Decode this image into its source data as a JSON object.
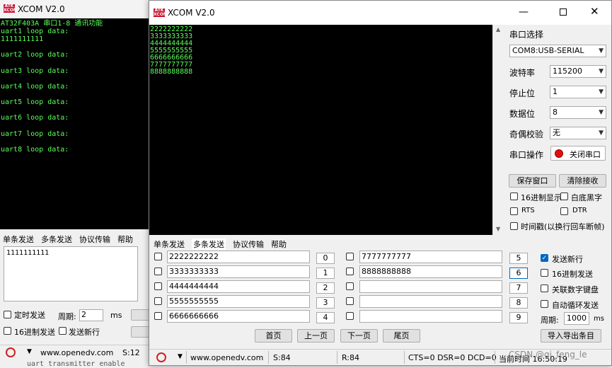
{
  "app_title": "XCOM V2.0",
  "logo_text": "ATK XCOM",
  "back": {
    "terminal_lines": [
      "AT32F403A 串口1-8 通讯功能",
      "uart1 loop data:",
      "1111111111",
      "",
      "uart2 loop data:",
      "",
      "uart3 loop data:",
      "",
      "uart4 loop data:",
      "",
      "uart5 loop data:",
      "",
      "uart6 loop data:",
      "",
      "uart7 loop data:",
      "",
      "uart8 loop data:"
    ],
    "tabs": [
      "单条发送",
      "多条发送",
      "协议传输",
      "帮助"
    ],
    "send_text": "1111111111",
    "timed_send": "定时发送",
    "period_label": "周期:",
    "period_value": "2",
    "period_unit": "ms",
    "hex_send": "16进制发送",
    "send_newline": "发送新行",
    "website": "www.openedv.com",
    "status_s": "S:12",
    "bottom_text": "uart transmitter enable"
  },
  "front": {
    "terminal_lines": [
      "2222222222",
      "3333333333",
      "4444444444",
      "5555555555",
      "6666666666",
      "7777777777",
      "8888888888"
    ],
    "right_panel": {
      "port_select_label": "串口选择",
      "port_value": "COM8:USB-SERIAL",
      "baud_label": "波特率",
      "baud_value": "115200",
      "stop_label": "停止位",
      "stop_value": "1",
      "data_label": "数据位",
      "data_value": "8",
      "parity_label": "奇偶校验",
      "parity_value": "无",
      "op_label": "串口操作",
      "close_port": "关闭串口",
      "save_window": "保存窗口",
      "clear_recv": "清除接收",
      "hex_display": "16进制显示",
      "white_black": "白底黑字",
      "rts": "RTS",
      "dtr": "DTR",
      "timestamp": "时间戳(以换行回车断帧)"
    },
    "tabs": [
      "单条发送",
      "多条发送",
      "协议传输",
      "帮助"
    ],
    "multi_send": {
      "left_entries": [
        {
          "text": "2222222222",
          "btn": "0"
        },
        {
          "text": "3333333333",
          "btn": "1"
        },
        {
          "text": "4444444444",
          "btn": "2"
        },
        {
          "text": "5555555555",
          "btn": "3"
        },
        {
          "text": "6666666666",
          "btn": "4"
        }
      ],
      "right_entries": [
        {
          "text": "7777777777",
          "btn": "5"
        },
        {
          "text": "8888888888",
          "btn": "6"
        },
        {
          "text": "",
          "btn": "7"
        },
        {
          "text": "",
          "btn": "8"
        },
        {
          "text": "",
          "btn": "9"
        }
      ],
      "send_newline": "发送新行",
      "hex_send": "16进制发送",
      "link_keyboard": "关联数字键盘",
      "auto_loop": "自动循环发送",
      "period_label": "周期:",
      "period_value": "1000",
      "period_unit": "ms",
      "first_page": "首页",
      "prev_page": "上一页",
      "next_page": "下一页",
      "last_page": "尾页",
      "import_export": "导入导出条目"
    },
    "status": {
      "website": "www.openedv.com",
      "s": "S:84",
      "r": "R:84",
      "signals": "CTS=0 DSR=0 DCD=0",
      "time_label": "当前时间 16:50:19"
    },
    "watermark": "CSDN @qi_feng_le"
  },
  "colors": {
    "terminal_bg": "#000000",
    "terminal_fg": "#5cff5c",
    "logo_red": "#c8102e",
    "accent": "#0067c0"
  }
}
